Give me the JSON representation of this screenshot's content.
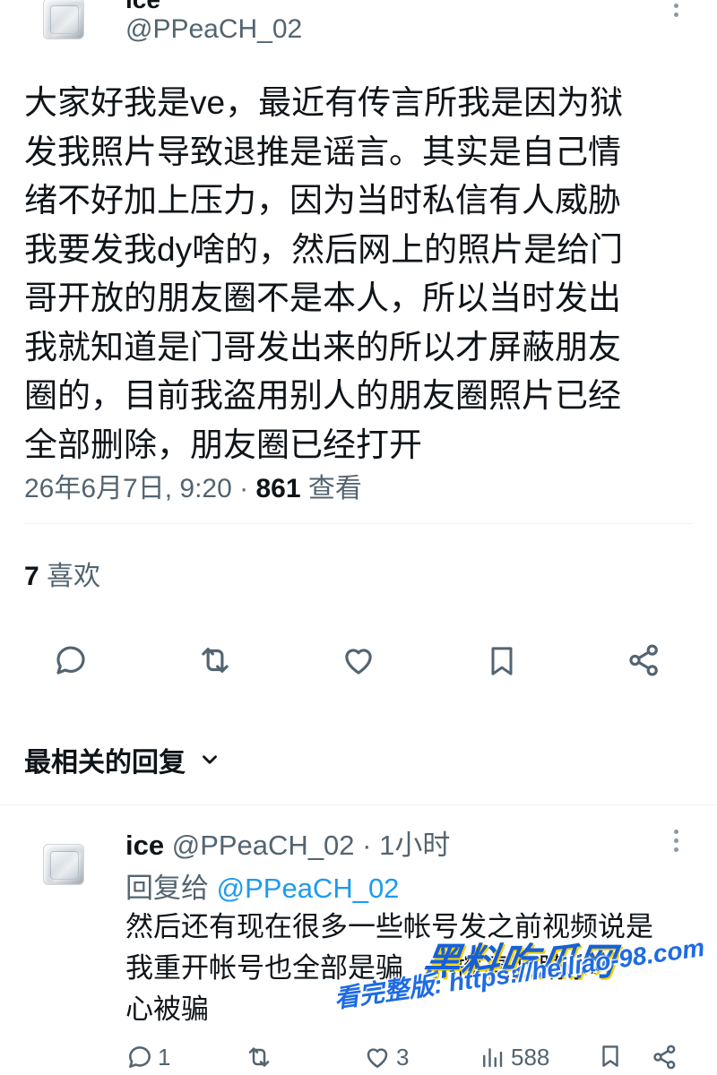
{
  "tweet": {
    "display_name": "ice",
    "handle": "@PPeaCH_02",
    "text_lines": [
      "大家好我是ve，最近有传言所我是因为狱",
      "发我照片导致退推是谣言。其实是自己情",
      "绪不好加上压力，因为当时私信有人威胁",
      "我要发我dy啥的，然后网上的照片是给门",
      "哥开放的朋友圈不是本人，所以当时发出",
      "我就知道是门哥发出来的所以才屏蔽朋友",
      "圈的，目前我盗用别人的朋友圈照片已经",
      "全部删除，朋友圈已经打开"
    ],
    "timestamp": "26年6月7日, 9:20 · ",
    "views_count": "861",
    "views_label": " 查看",
    "likes_count": "7",
    "likes_label": " 喜欢",
    "actions": [
      "reply-icon",
      "retweet-icon",
      "like-icon",
      "bookmark-icon",
      "share-icon"
    ]
  },
  "replies_section": {
    "sort_label": "最相关的回复"
  },
  "reply": {
    "display_name": "ice",
    "handle": "@PPeaCH_02",
    "time": " · 1小时",
    "replying_to_label": "回复给 ",
    "replying_to_handle": "@PPeaCH_02",
    "text_lines": [
      "然后还有现在很多一些帐号发之前视频说是",
      "我重开帐号也全部是骗",
      "心被骗"
    ],
    "text_line2_tail": "擦亮眼睛小",
    "reply_count": "1",
    "like_count": "3",
    "view_count": "588"
  },
  "watermark": {
    "title": "黑料吃瓜网",
    "url": "看完整版: https://heiliao-98.com"
  },
  "colors": {
    "text": "#0f1419",
    "muted": "#536471",
    "link": "#1d9bf0",
    "divider": "#eff3f4"
  }
}
